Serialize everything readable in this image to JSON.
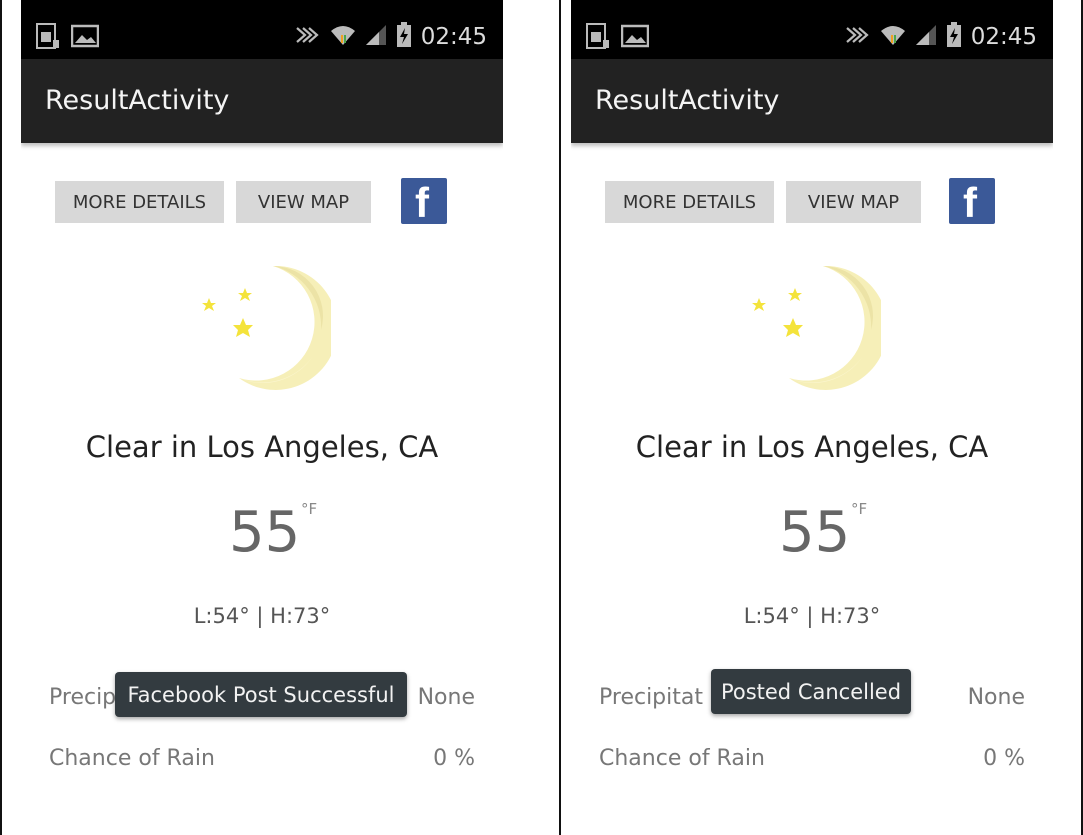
{
  "screens": [
    {
      "status_time": "02:45",
      "app_title": "ResultActivity",
      "btn_more": "MORE DETAILS",
      "btn_map": "VIEW MAP",
      "facebook_glyph": "f",
      "weather_title": "Clear in Los Angeles, CA",
      "temperature": "55",
      "temp_unit": "°F",
      "hilo": "L:54° | H:73°",
      "precip_label": "Precip",
      "precip_value": "None",
      "rain_label": "Chance of Rain",
      "rain_value": "0 %",
      "toast": "Facebook Post Successful"
    },
    {
      "status_time": "02:45",
      "app_title": "ResultActivity",
      "btn_more": "MORE DETAILS",
      "btn_map": "VIEW MAP",
      "facebook_glyph": "f",
      "weather_title": "Clear in Los Angeles, CA",
      "temperature": "55",
      "temp_unit": "°F",
      "hilo": "L:54° | H:73°",
      "precip_label": "Precipitat",
      "precip_value": "None",
      "rain_label": "Chance of Rain",
      "rain_value": "0 %",
      "toast": "Posted Cancelled"
    }
  ],
  "colors": {
    "status_bar": "#000000",
    "app_bar": "#222222",
    "button_bg": "#d8d8d8",
    "facebook_blue": "#3b5998",
    "toast_bg": "#333b40",
    "moon": "#f6efb8",
    "star": "#f4e33b"
  },
  "icons": [
    "sim-icon",
    "image-icon",
    "nfc-icon",
    "wifi-icon",
    "signal-icon",
    "battery-charging-icon",
    "facebook-icon",
    "moon-icon",
    "star-icon"
  ]
}
